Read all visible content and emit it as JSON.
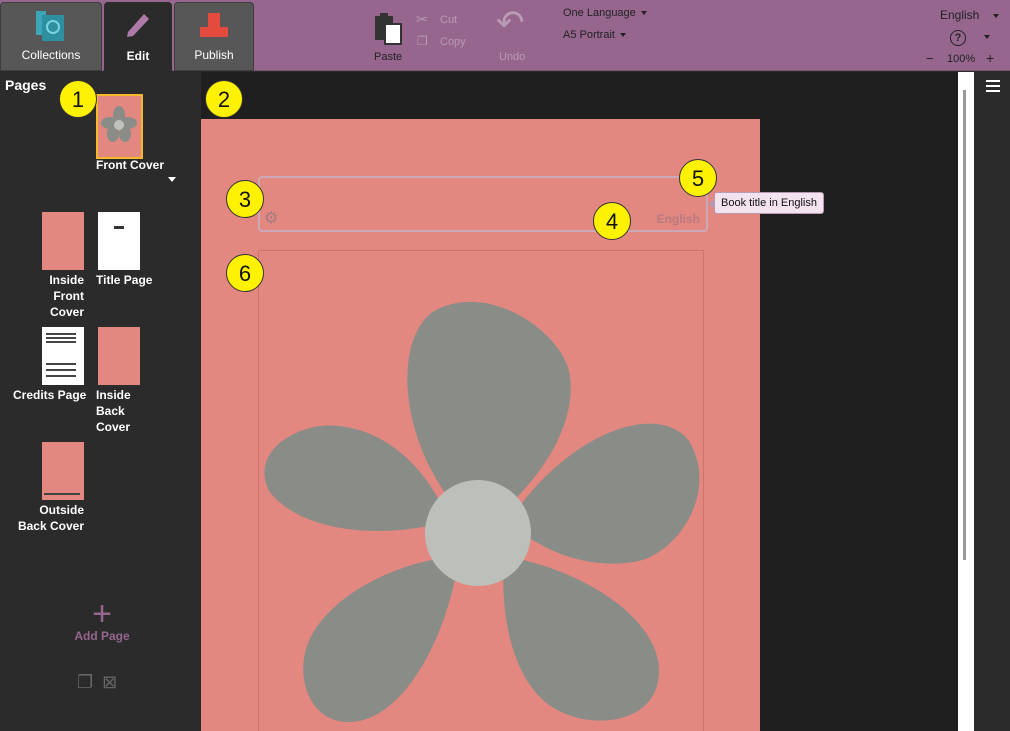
{
  "toolbar": {
    "tabs": [
      {
        "label": "Collections"
      },
      {
        "label": "Edit"
      },
      {
        "label": "Publish"
      }
    ],
    "paste": "Paste",
    "cut": "Cut",
    "copy": "Copy",
    "undo": "Undo",
    "language_mode": "One Language",
    "page_size": "A5 Portrait",
    "ui_language": "English",
    "zoom": "100%",
    "zoom_minus": "−",
    "zoom_plus": "+"
  },
  "pages_panel": {
    "title": "Pages",
    "pages": [
      {
        "label": "Front Cover"
      },
      {
        "label": "Inside Front Cover"
      },
      {
        "label": "Title Page"
      },
      {
        "label": "Credits Page"
      },
      {
        "label": "Inside Back Cover"
      },
      {
        "label": "Outside Back Cover"
      }
    ],
    "add_page": "Add Page"
  },
  "editor": {
    "title_language_tag": "English",
    "tooltip": "Book title in English"
  },
  "callouts": [
    "1",
    "2",
    "3",
    "4",
    "5",
    "6"
  ],
  "colors": {
    "toolbar": "#96668f",
    "page": "#e38880",
    "flower": "#8a8c87",
    "callout": "#fff200",
    "selected_page": "#f5b92e"
  }
}
